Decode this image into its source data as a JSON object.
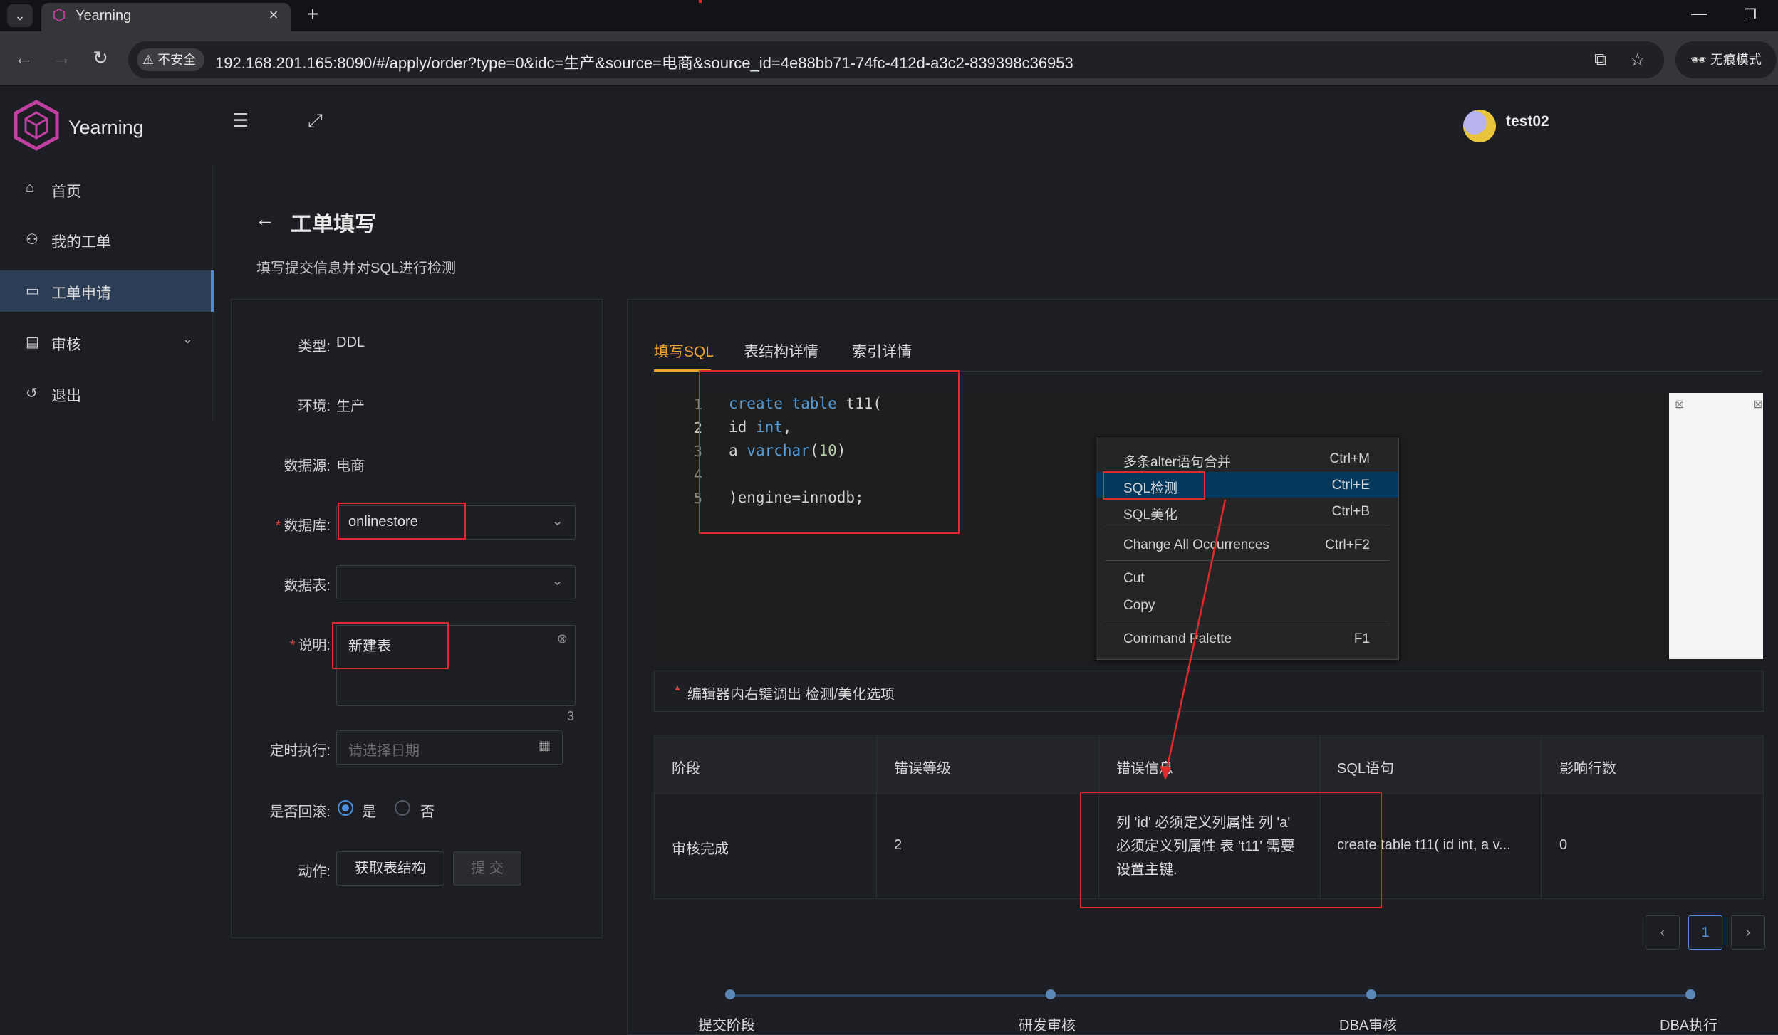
{
  "browser": {
    "tab_title": "Yearning",
    "tab_close": "×",
    "new_tab": "+",
    "menu_glyph": "⌄",
    "insecure_label": "不安全",
    "url": "192.168.201.165:8090/#/apply/order?type=0&idc=生产&source=电商&source_id=4e88bb71-74fc-412d-a3c2-839398c36953",
    "incognito_label": "无痕模式"
  },
  "app": {
    "logo_text": "Yearning",
    "user": "test02"
  },
  "sidebar": {
    "items": [
      {
        "label": "首页",
        "icon": "home-icon"
      },
      {
        "label": "我的工单",
        "icon": "user-icon"
      },
      {
        "label": "工单申请",
        "icon": "monitor-icon",
        "active": true
      },
      {
        "label": "审核",
        "icon": "audit-icon",
        "expandable": true
      },
      {
        "label": "退出",
        "icon": "logout-icon"
      }
    ]
  },
  "page": {
    "title": "工单填写",
    "subtitle": "填写提交信息并对SQL进行检测"
  },
  "form": {
    "type_label": "类型:",
    "type_value": "DDL",
    "env_label": "环境:",
    "env_value": "生产",
    "source_label": "数据源:",
    "source_value": "电商",
    "db_label": "数据库:",
    "db_value": "onlinestore",
    "table_label": "数据表:",
    "table_value": "",
    "desc_label": "说明:",
    "desc_value": "新建表",
    "desc_count": "3",
    "schedule_label": "定时执行:",
    "schedule_placeholder": "请选择日期",
    "rollback_label": "是否回滚:",
    "rollback_yes": "是",
    "rollback_no": "否",
    "rollback_selected": "是",
    "action_label": "动作:",
    "fetch_button": "获取表结构",
    "submit_button": "提 交"
  },
  "editor": {
    "tabs": [
      "填写SQL",
      "表结构详情",
      "索引详情"
    ],
    "active_tab": "填写SQL",
    "lines": [
      "1",
      "2",
      "3",
      "4",
      "5"
    ],
    "context_menu": [
      {
        "label": "多条alter语句合并",
        "shortcut": "Ctrl+M"
      },
      {
        "label": "SQL检测",
        "shortcut": "Ctrl+E",
        "selected": true
      },
      {
        "label": "SQL美化",
        "shortcut": "Ctrl+B"
      },
      {
        "label": "Change All Occurrences",
        "shortcut": "Ctrl+F2"
      },
      {
        "label": "Cut",
        "shortcut": ""
      },
      {
        "label": "Copy",
        "shortcut": ""
      },
      {
        "label": "Command Palette",
        "shortcut": "F1"
      }
    ],
    "hint": "编辑器内右键调出 检测/美化选项"
  },
  "results": {
    "headers": [
      "阶段",
      "错误等级",
      "错误信息",
      "SQL语句",
      "影响行数"
    ],
    "rows": [
      [
        "审核完成",
        "2",
        "列 'id' 必须定义列属性 列 'a' 必须定义列属性 表 't11' 需要设置主键.",
        "create table t11( id int, a v...",
        "0"
      ]
    ],
    "page": "1"
  },
  "steps": [
    "提交阶段",
    "研发审核",
    "DBA审核",
    "DBA执行"
  ],
  "colors": {
    "accent": "#f0a42b",
    "active_menu": "#2c3e55",
    "annotation_red": "#e02b2b",
    "link_blue": "#4a8fe0"
  }
}
